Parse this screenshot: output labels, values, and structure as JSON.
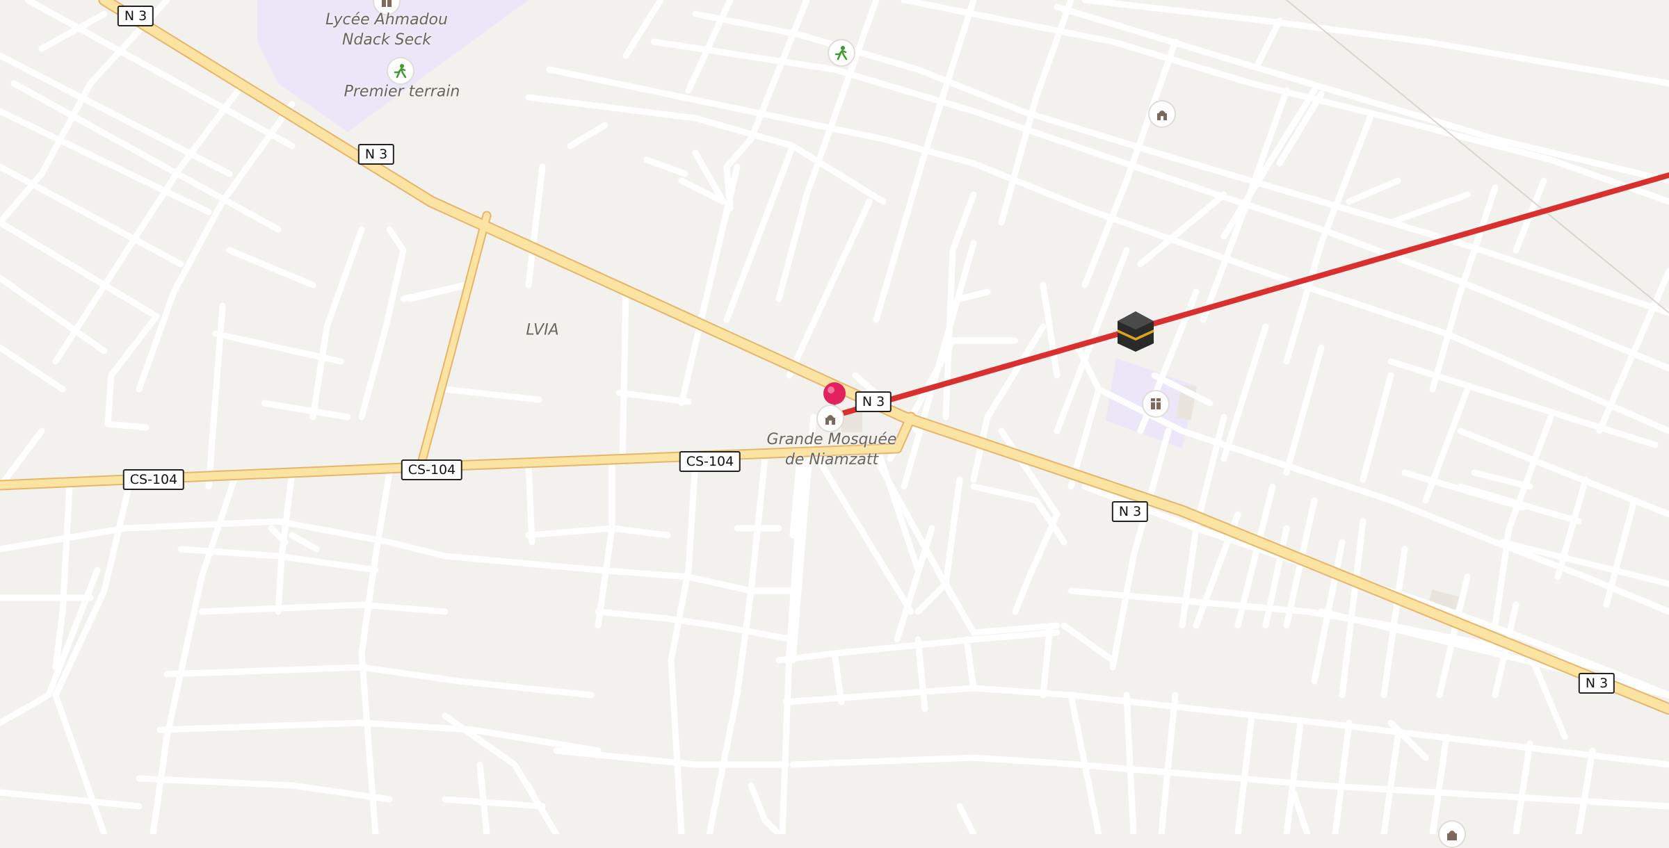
{
  "map": {
    "road_shields": {
      "n3_a": "N 3",
      "n3_b": "N 3",
      "n3_c": "N 3",
      "n3_d": "N 3",
      "n3_e": "N 3",
      "cs104_a": "CS-104",
      "cs104_b": "CS-104",
      "cs104_c": "CS-104"
    },
    "places": {
      "lycee": "Lycée Ahmadou\nNdack Seck",
      "terrain": "Premier terrain",
      "lvia": "LVIA",
      "mosque": "Grande Mosquée\nde Niamzatt"
    },
    "icons": {
      "location_pin": "location-pin-icon",
      "kaaba": "kaaba-icon",
      "mosque": "mosque-icon",
      "school": "school-icon",
      "sports": "sports-field-icon"
    },
    "colors": {
      "background": "#f3f1ee",
      "road_minor": "#ffffff",
      "road_major": "#fbe3a2",
      "road_major_casing": "#e6b56a",
      "qibla_line": "#d9302f",
      "pin": "#e4215f",
      "school_area": "#ebe6f8"
    }
  }
}
